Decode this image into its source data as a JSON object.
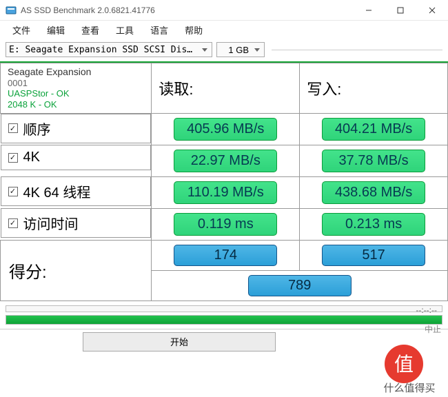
{
  "window": {
    "title": "AS SSD Benchmark 2.0.6821.41776"
  },
  "menu": {
    "file": "文件",
    "edit": "编辑",
    "view": "查看",
    "tools": "工具",
    "lang": "语言",
    "help": "帮助"
  },
  "toolbar": {
    "drive": "E: Seagate Expansion SSD SCSI Dis…",
    "size": "1 GB"
  },
  "device": {
    "name": "Seagate Expansion",
    "fw": "0001",
    "driver": "UASPStor - OK",
    "align": "2048 K - OK"
  },
  "headers": {
    "read": "读取:",
    "write": "写入:"
  },
  "tests": {
    "seq": {
      "label": "顺序",
      "read": "405.96 MB/s",
      "write": "404.21 MB/s"
    },
    "k4": {
      "label": "4K",
      "read": "22.97 MB/s",
      "write": "37.78 MB/s"
    },
    "k4_64": {
      "label": "4K 64 线程",
      "read": "110.19 MB/s",
      "write": "438.68 MB/s"
    },
    "acc": {
      "label": "访问时间",
      "read": "0.119 ms",
      "write": "0.213 ms"
    }
  },
  "score": {
    "label": "得分:",
    "read": "174",
    "write": "517",
    "total": "789"
  },
  "footer": {
    "start": "开始",
    "abort": "中止",
    "time": "--:--:--"
  },
  "watermark": {
    "brand": "什么值得买",
    "logo": "值"
  },
  "checkbox_glyph": "☑"
}
